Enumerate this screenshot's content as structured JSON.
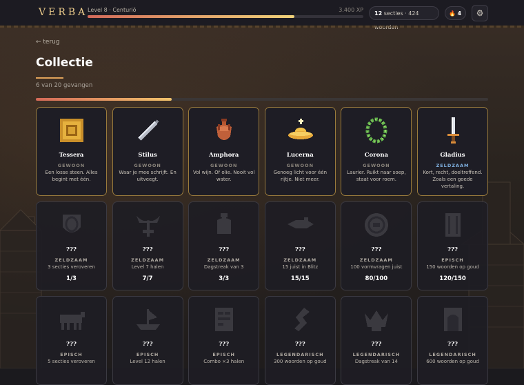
{
  "header": {
    "logo": "VERBA",
    "level": "Level 8 · Centuriō",
    "xp_progress": 0.75,
    "xp": "3.400 XP",
    "stats_sections": "12",
    "stats_rest": "secties · 424 woorden",
    "streak_icon": "🔥",
    "streak": "4",
    "settings_icon": "⚙"
  },
  "page": {
    "back": "← terug",
    "title": "Collectie",
    "subtitle": "6 van 20 gevangen",
    "progress": 0.3
  },
  "colors": {
    "gold_border": "#9a7b3c",
    "zeldzaam": "#7fb0e0",
    "accent": "#e0a35a"
  },
  "cards": [
    {
      "name": "Tessera",
      "rarity": "GEWOON",
      "desc": "Een losse steen. Alles begint met één.",
      "icon": "tile-icon",
      "count": ""
    },
    {
      "name": "Stilus",
      "rarity": "GEWOON",
      "desc": "Waar je mee schrijft. En uitveegt.",
      "icon": "stylus-icon",
      "count": ""
    },
    {
      "name": "Amphora",
      "rarity": "GEWOON",
      "desc": "Vol wijn. Of olie. Nooit vol water.",
      "icon": "amphora-icon",
      "count": ""
    },
    {
      "name": "Lucerna",
      "rarity": "GEWOON",
      "desc": "Genoeg licht voor één rijtje. Niet meer.",
      "icon": "oil-lamp-icon",
      "count": ""
    },
    {
      "name": "Corona",
      "rarity": "GEWOON",
      "desc": "Laurier. Ruikt naar soep, staat voor roem.",
      "icon": "laurel-wreath-icon",
      "count": ""
    },
    {
      "name": "Gladius",
      "rarity": "ZELDZAAM",
      "desc": "Kort, recht, doeltreffend. Zoals een goede vertaling.",
      "icon": "sword-icon",
      "count": ""
    },
    {
      "name": "???",
      "rarity": "ZELDZAAM",
      "desc": "3 secties veroveren",
      "icon": "shield-silhouette-icon",
      "count": "1/3"
    },
    {
      "name": "???",
      "rarity": "ZELDZAAM",
      "desc": "Level 7 halen",
      "icon": "eagle-standard-silhouette-icon",
      "count": "7/7"
    },
    {
      "name": "???",
      "rarity": "ZELDZAAM",
      "desc": "Dagstreak van 3",
      "icon": "vase-silhouette-icon",
      "count": "3/3"
    },
    {
      "name": "???",
      "rarity": "ZELDZAAM",
      "desc": "15 juist in Blitz",
      "icon": "bird-silhouette-icon",
      "count": "15/15"
    },
    {
      "name": "???",
      "rarity": "ZELDZAAM",
      "desc": "100 vormvragen juist",
      "icon": "coin-silhouette-icon",
      "count": "80/100"
    },
    {
      "name": "???",
      "rarity": "EPISCH",
      "desc": "150 woorden op goud",
      "icon": "scroll-silhouette-icon",
      "count": "120/150"
    },
    {
      "name": "???",
      "rarity": "EPISCH",
      "desc": "5 secties veroveren",
      "icon": "bull-silhouette-icon",
      "count": ""
    },
    {
      "name": "???",
      "rarity": "EPISCH",
      "desc": "Level 12 halen",
      "icon": "ship-silhouette-icon",
      "count": ""
    },
    {
      "name": "???",
      "rarity": "EPISCH",
      "desc": "Combo ×3 halen",
      "icon": "tablet-silhouette-icon",
      "count": ""
    },
    {
      "name": "???",
      "rarity": "LEGENDARISCH",
      "desc": "300 woorden op goud",
      "icon": "serpent-silhouette-icon",
      "count": ""
    },
    {
      "name": "???",
      "rarity": "LEGENDARISCH",
      "desc": "Dagstreak van 14",
      "icon": "crown-silhouette-icon",
      "count": ""
    },
    {
      "name": "???",
      "rarity": "LEGENDARISCH",
      "desc": "600 woorden op goud",
      "icon": "gate-silhouette-icon",
      "count": ""
    }
  ]
}
